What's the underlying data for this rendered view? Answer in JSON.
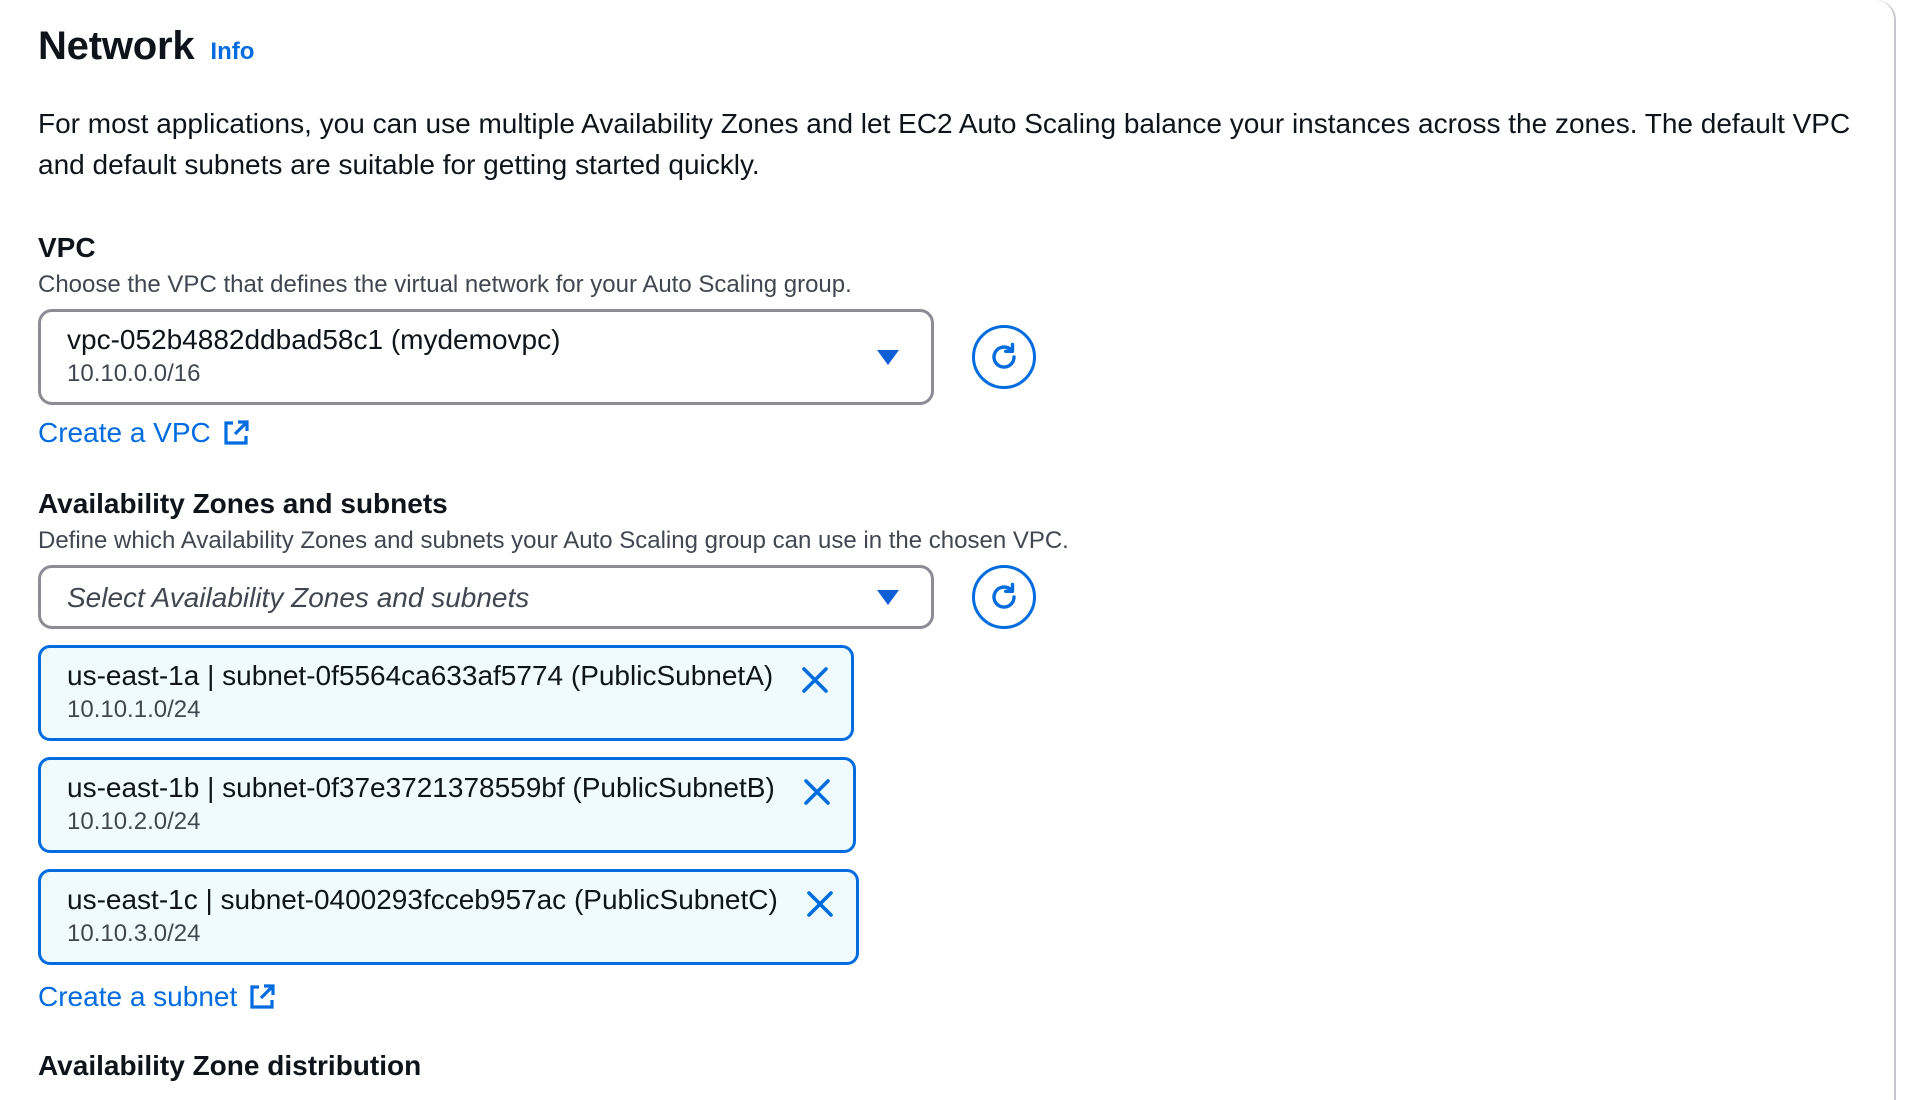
{
  "network": {
    "title": "Network",
    "info_label": "Info",
    "description": "For most applications, you can use multiple Availability Zones and let EC2 Auto Scaling balance your instances across the zones. The default VPC and default subnets are suitable for getting started quickly."
  },
  "vpc": {
    "label": "VPC",
    "hint": "Choose the VPC that defines the virtual network for your Auto Scaling group.",
    "selected_value": "vpc-052b4882ddbad58c1 (mydemovpc)",
    "selected_cidr": "10.10.0.0/16",
    "create_link": "Create a VPC"
  },
  "az": {
    "label": "Availability Zones and subnets",
    "hint": "Define which Availability Zones and subnets your Auto Scaling group can use in the chosen VPC.",
    "placeholder": "Select Availability Zones and subnets",
    "create_link": "Create a subnet",
    "selected_subnets": [
      {
        "label": "us-east-1a | subnet-0f5564ca633af5774 (PublicSubnetA)",
        "cidr": "10.10.1.0/24"
      },
      {
        "label": "us-east-1b | subnet-0f37e3721378559bf (PublicSubnetB)",
        "cidr": "10.10.2.0/24"
      },
      {
        "label": "us-east-1c | subnet-0400293fcceb957ac (PublicSubnetC)",
        "cidr": "10.10.3.0/24"
      }
    ]
  },
  "next_section": {
    "label": "Availability Zone distribution"
  },
  "colors": {
    "link": "#006ce0",
    "token_border": "#006ce0",
    "token_bg": "#f0fbff",
    "input_border": "#8c8c94",
    "text": "#0f141a",
    "secondary_text": "#424650"
  }
}
